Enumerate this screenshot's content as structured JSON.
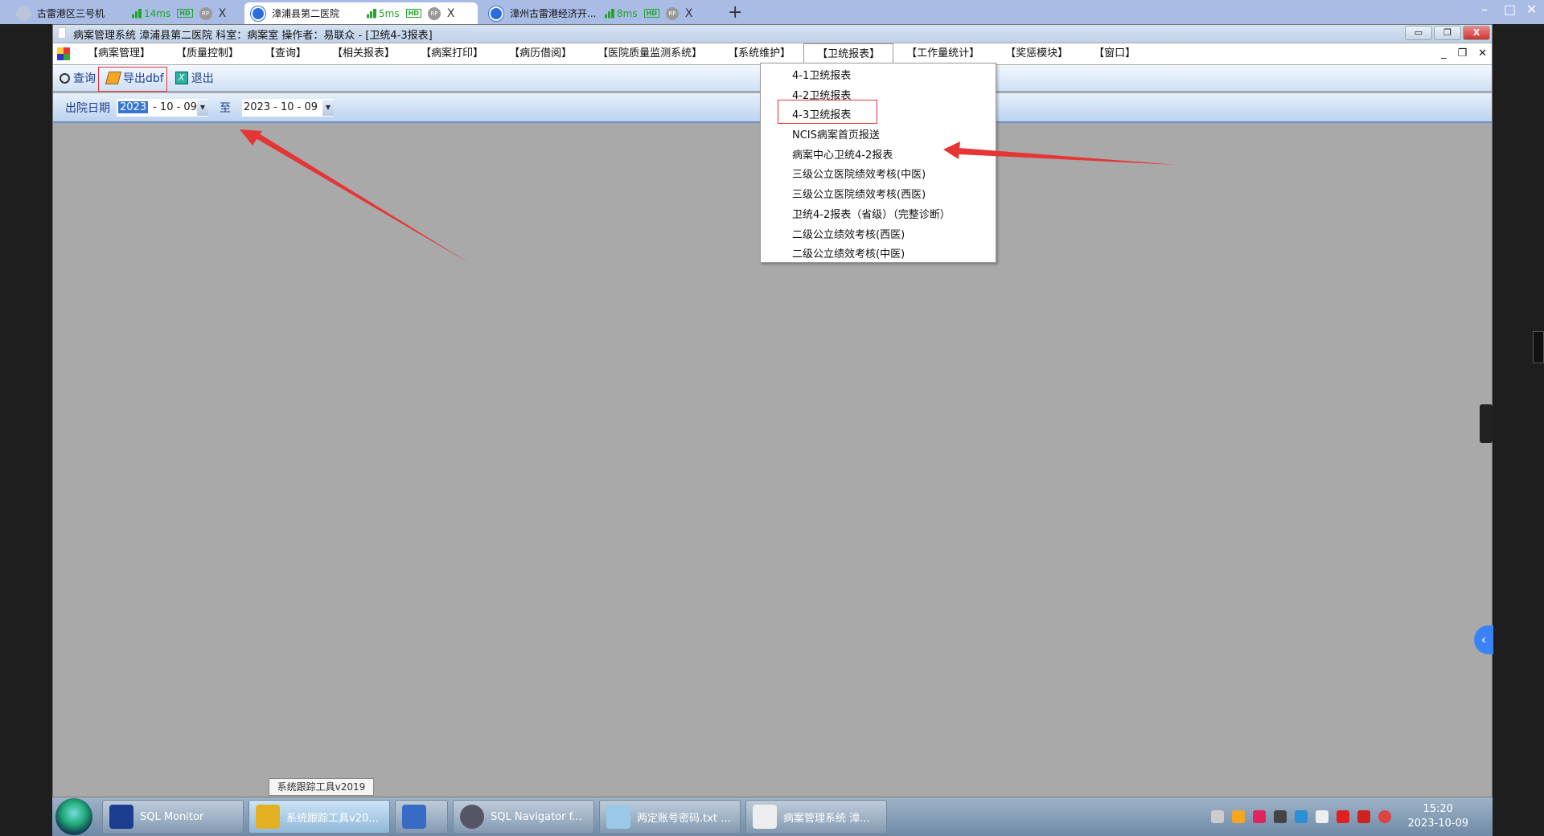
{
  "browser_tabs": [
    {
      "title": "古雷港区三号机",
      "ping": "14ms",
      "hd": "HD",
      "rp": "RP",
      "close": "X",
      "active": false
    },
    {
      "title": "漳浦县第二医院",
      "ping": "5ms",
      "hd": "HD",
      "rp": "RP",
      "close": "X",
      "active": true
    },
    {
      "title": "漳州古雷港经济开...",
      "ping": "8ms",
      "hd": "HD",
      "rp": "RP",
      "close": "X",
      "active": false
    }
  ],
  "new_tab": "+",
  "window_title": "病案管理系统  漳浦县第二医院  科室：病案室 操作者：易联众 - [卫统4-3报表]",
  "menu": [
    "【病案管理】",
    "【质量控制】",
    "【查询】",
    "【相关报表】",
    "【病案打印】",
    "【病历借阅】",
    "【医院质量监测系统】",
    "【系统维护】",
    "【卫统报表】",
    "【工作量统计】",
    "【奖惩模块】",
    "【窗口】"
  ],
  "open_menu_index": 8,
  "dropdown_items": [
    "4-1卫统报表",
    "4-2卫统报表",
    "4-3卫统报表",
    "NCIS病案首页报送",
    "病案中心卫统4-2报表",
    "三级公立医院绩效考核(中医)",
    "三级公立医院绩效考核(西医)",
    "卫统4-2报表（省级）（完整诊断）",
    "二级公立绩效考核(西医)",
    "二级公立绩效考核(中医)"
  ],
  "toolbar": {
    "query": "查询",
    "export": "导出dbf",
    "exit": "退出"
  },
  "datebar": {
    "label": "出院日期",
    "from_year": "2023",
    "from_rest": "- 10 - 09",
    "to_label": "至",
    "to": "2023 - 10 - 09"
  },
  "tooltip": "系统跟踪工具v2019",
  "taskbar": [
    {
      "label": "SQL Monitor",
      "color": "#1a3d8f"
    },
    {
      "label": "系统跟踪工具v20...",
      "color": "#e3b022"
    },
    {
      "label": "",
      "color": "#3a6bc4"
    },
    {
      "label": "SQL Navigator f...",
      "color": "#556"
    },
    {
      "label": "两定账号密码.txt ...",
      "color": "#9cc8e8"
    },
    {
      "label": "病案管理系统  漳...",
      "color": "#eee"
    }
  ],
  "clock": {
    "time": "15:20",
    "date": "2023-10-09"
  },
  "colors": {
    "annotation": "#e53535",
    "accent": "#3875d7"
  }
}
